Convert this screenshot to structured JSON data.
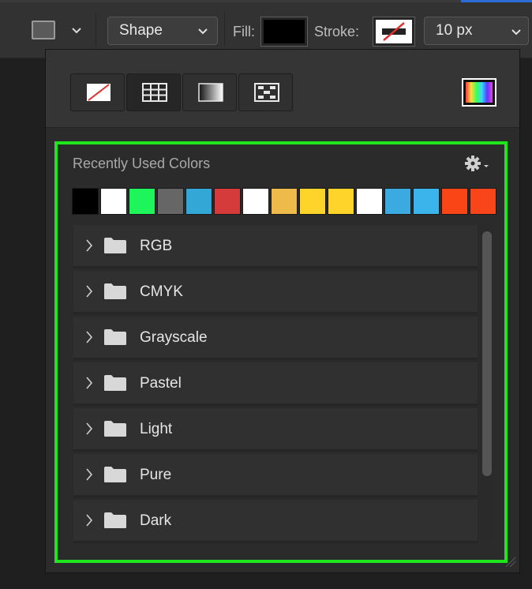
{
  "toolbar": {
    "shape_dropdown": "Shape",
    "fill_label": "Fill:",
    "stroke_label": "Stroke:",
    "stroke_width": "10 px",
    "fill_color": "#000000"
  },
  "panel": {
    "type_buttons": [
      {
        "name": "no-color",
        "icon": "no-color-icon"
      },
      {
        "name": "solid-color",
        "icon": "solid-color-grid-icon",
        "selected": true
      },
      {
        "name": "gradient",
        "icon": "gradient-icon"
      },
      {
        "name": "pattern",
        "icon": "pattern-icon"
      }
    ],
    "color_picker_icon": "color-picker-spectrum-icon",
    "recent_label": "Recently Used Colors",
    "settings_icon": "gear-icon",
    "recent_colors": [
      "#000000",
      "#ffffff",
      "#1ef55a",
      "#666666",
      "#33a8d6",
      "#d63b3b",
      "#ffffff",
      "#eeba4a",
      "#ffd42a",
      "#ffd42a",
      "#ffffff",
      "#3aaae0",
      "#3ab4ea",
      "#fa4616",
      "#f8461a"
    ],
    "folders": [
      "RGB",
      "CMYK",
      "Grayscale",
      "Pastel",
      "Light",
      "Pure",
      "Dark"
    ],
    "highlight_color": "#1ee51e"
  }
}
